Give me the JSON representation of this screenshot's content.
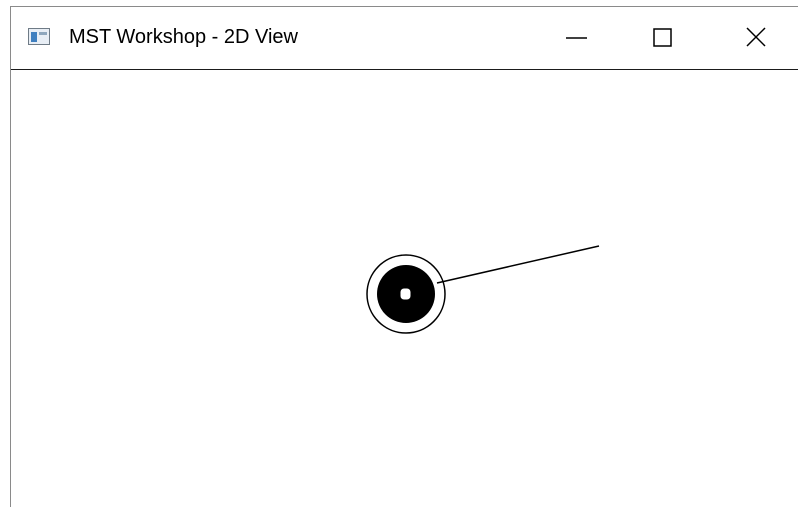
{
  "window": {
    "title": "MST Workshop - 2D View",
    "app_icon": "window-app-icon",
    "controls": {
      "minimize_icon": "minimize-icon",
      "maximize_icon": "maximize-icon",
      "close_icon": "close-icon"
    }
  },
  "canvas": {
    "background_color": "#ffffff",
    "stroke_color": "#000000",
    "node_fill_color": "#000000",
    "marker_fill_color": "#ffffff"
  }
}
